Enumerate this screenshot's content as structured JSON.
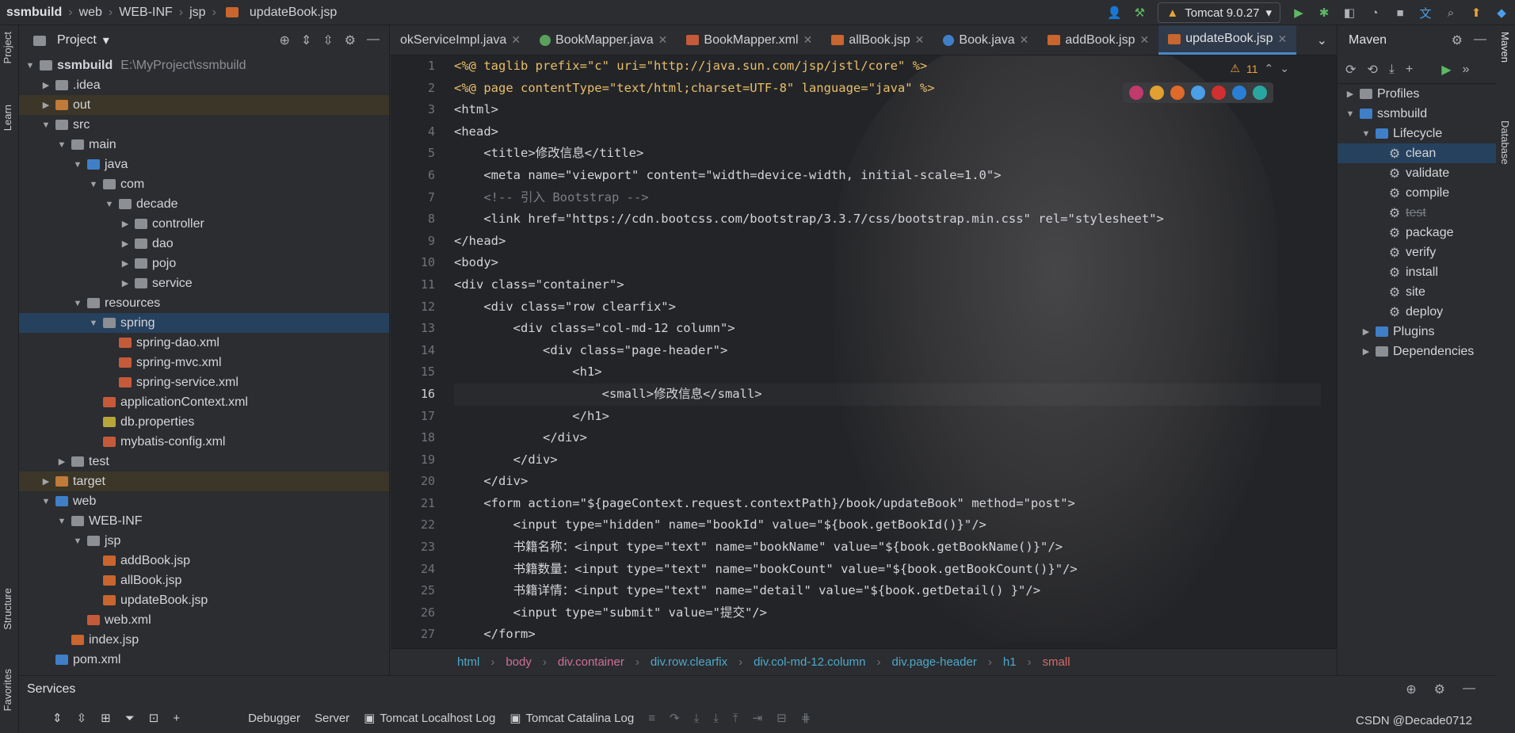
{
  "breadcrumb": [
    "ssmbuild",
    "web",
    "WEB-INF",
    "jsp",
    "updateBook.jsp"
  ],
  "run_config": "Tomcat 9.0.27",
  "left_strip": {
    "project": "Project",
    "learn": "Learn",
    "structure": "Structure",
    "favorites": "Favorites"
  },
  "project_panel": {
    "title": "Project",
    "tree": [
      {
        "label": "ssmbuild",
        "path": "E:\\MyProject\\ssmbuild"
      },
      {
        "label": ".idea"
      },
      {
        "label": "out"
      },
      {
        "label": "src"
      },
      {
        "label": "main"
      },
      {
        "label": "java"
      },
      {
        "label": "com"
      },
      {
        "label": "decade"
      },
      {
        "label": "controller"
      },
      {
        "label": "dao"
      },
      {
        "label": "pojo"
      },
      {
        "label": "service"
      },
      {
        "label": "resources"
      },
      {
        "label": "spring"
      },
      {
        "label": "spring-dao.xml"
      },
      {
        "label": "spring-mvc.xml"
      },
      {
        "label": "spring-service.xml"
      },
      {
        "label": "applicationContext.xml"
      },
      {
        "label": "db.properties"
      },
      {
        "label": "mybatis-config.xml"
      },
      {
        "label": "test"
      },
      {
        "label": "target"
      },
      {
        "label": "web"
      },
      {
        "label": "WEB-INF"
      },
      {
        "label": "jsp"
      },
      {
        "label": "addBook.jsp"
      },
      {
        "label": "allBook.jsp"
      },
      {
        "label": "updateBook.jsp"
      },
      {
        "label": "web.xml"
      },
      {
        "label": "index.jsp"
      },
      {
        "label": "pom.xml"
      }
    ]
  },
  "tabs": [
    "okServiceImpl.java",
    "BookMapper.java",
    "BookMapper.xml",
    "allBook.jsp",
    "Book.java",
    "addBook.jsp",
    "updateBook.jsp"
  ],
  "editor": {
    "line_numbers": [
      "1",
      "2",
      "3",
      "4",
      "5",
      "6",
      "7",
      "8",
      "9",
      "10",
      "11",
      "12",
      "13",
      "14",
      "15",
      "16",
      "17",
      "18",
      "19",
      "20",
      "21",
      "22",
      "23",
      "24",
      "25",
      "26",
      "27"
    ],
    "warnings": "11",
    "lines": [
      "<%@ taglib prefix=\"c\" uri=\"http://java.sun.com/jsp/jstl/core\" %>",
      "<%@ page contentType=\"text/html;charset=UTF-8\" language=\"java\" %>",
      "<html>",
      "<head>",
      "    <title>修改信息</title>",
      "    <meta name=\"viewport\" content=\"width=device-width, initial-scale=1.0\">",
      "    <!-- 引入 Bootstrap -->",
      "    <link href=\"https://cdn.bootcss.com/bootstrap/3.3.7/css/bootstrap.min.css\" rel=\"stylesheet\">",
      "</head>",
      "<body>",
      "<div class=\"container\">",
      "    <div class=\"row clearfix\">",
      "        <div class=\"col-md-12 column\">",
      "            <div class=\"page-header\">",
      "                <h1>",
      "                    <small>修改信息</small>",
      "                </h1>",
      "            </div>",
      "        </div>",
      "    </div>",
      "    <form action=\"${pageContext.request.contextPath}/book/updateBook\" method=\"post\">",
      "        <input type=\"hidden\" name=\"bookId\" value=\"${book.getBookId()}\"/>",
      "        书籍名称：<input type=\"text\" name=\"bookName\" value=\"${book.getBookName()}\"/>",
      "        书籍数量：<input type=\"text\" name=\"bookCount\" value=\"${book.getBookCount()}\"/>",
      "        书籍详情：<input type=\"text\" name=\"detail\" value=\"${book.getDetail() }\"/>",
      "        <input type=\"submit\" value=\"提交\"/>",
      "    </form>"
    ]
  },
  "element_breadcrumb": [
    "html",
    "body",
    "div.container",
    "div.row.clearfix",
    "div.col-md-12.column",
    "div.page-header",
    "h1",
    "small"
  ],
  "maven": {
    "title": "Maven",
    "profiles": "Profiles",
    "project": "ssmbuild",
    "lifecycle": "Lifecycle",
    "goals": [
      "clean",
      "validate",
      "compile",
      "test",
      "package",
      "verify",
      "install",
      "site",
      "deploy"
    ],
    "plugins": "Plugins",
    "dependencies": "Dependencies"
  },
  "right_strip": {
    "maven": "Maven",
    "database": "Database"
  },
  "services": {
    "title": "Services",
    "tabs": [
      "Debugger",
      "Server",
      "Tomcat Localhost Log",
      "Tomcat Catalina Log"
    ]
  },
  "watermark": "CSDN @Decade0712"
}
